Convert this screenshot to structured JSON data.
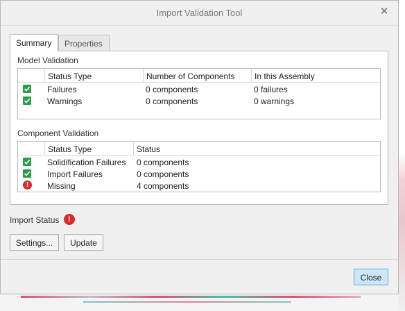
{
  "window": {
    "title": "Import Validation Tool",
    "close_glyph": "✕"
  },
  "tabs": [
    {
      "label": "Summary",
      "active": true
    },
    {
      "label": "Properties",
      "active": false
    }
  ],
  "model_validation": {
    "label": "Model Validation",
    "columns": [
      "Status Type",
      "Number of Components",
      "In this Assembly"
    ],
    "rows": [
      {
        "icon": "check-icon",
        "status_type": "Failures",
        "components": "0 components",
        "assembly": "0 failures"
      },
      {
        "icon": "check-icon",
        "status_type": "Warnings",
        "components": "0 components",
        "assembly": "0 warnings"
      }
    ]
  },
  "component_validation": {
    "label": "Component Validation",
    "columns": [
      "Status Type",
      "Status"
    ],
    "rows": [
      {
        "icon": "check-icon",
        "status_type": "Solidification Failures",
        "status": "0 components"
      },
      {
        "icon": "check-icon",
        "status_type": "Import Failures",
        "status": "0 components"
      },
      {
        "icon": "error-icon",
        "status_type": "Missing",
        "status": "4 components"
      }
    ]
  },
  "import_status": {
    "label": "Import Status",
    "icon": "error-icon",
    "glyph": "!"
  },
  "buttons": {
    "settings": "Settings...",
    "update": "Update",
    "close": "Close"
  },
  "colors": {
    "check": "#2a9d4a",
    "error": "#d92b2b",
    "close_button_bg": "#cce8f8"
  }
}
